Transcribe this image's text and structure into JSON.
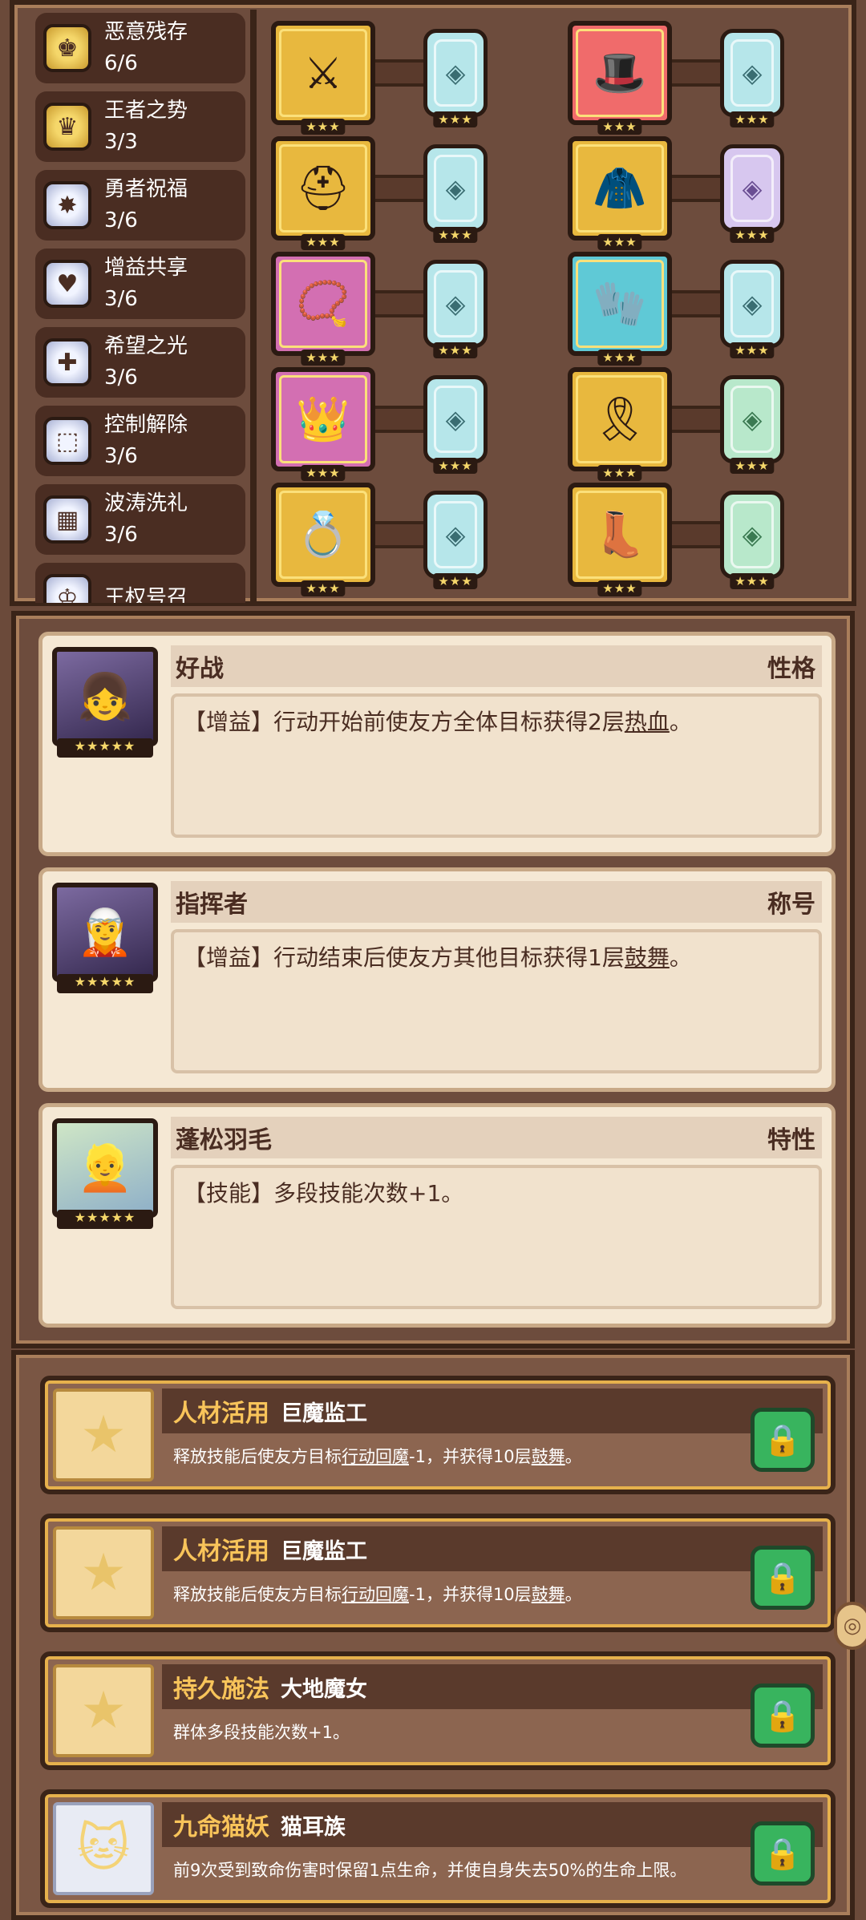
{
  "sets": [
    {
      "name": "恶意残存",
      "count": "6/6",
      "icon": "gold-medal-icon",
      "tone": "gold"
    },
    {
      "name": "王者之势",
      "count": "3/3",
      "icon": "gold-emblem-icon",
      "tone": "gold"
    },
    {
      "name": "勇者祝福",
      "count": "3/6",
      "icon": "silver-star-icon",
      "tone": "silver"
    },
    {
      "name": "增益共享",
      "count": "3/6",
      "icon": "silver-heart-icon",
      "tone": "silver"
    },
    {
      "name": "希望之光",
      "count": "3/6",
      "icon": "silver-plus-icon",
      "tone": "silver"
    },
    {
      "name": "控制解除",
      "count": "3/6",
      "icon": "silver-lock-icon",
      "tone": "silver"
    },
    {
      "name": "波涛洗礼",
      "count": "3/6",
      "icon": "silver-wave-icon",
      "tone": "silver"
    },
    {
      "name": "王权号召",
      "count": "",
      "icon": "silver-crown-icon",
      "tone": "silver"
    }
  ],
  "equip_rows": [
    {
      "left": {
        "icon": "sword-icon",
        "glyph": "⚔",
        "tone": "gold",
        "stars": "★★★",
        "gem": "gem-icon",
        "gem_glyph": "◈",
        "gem_tone": "cyan"
      },
      "right": {
        "icon": "hat-icon",
        "glyph": "🎩",
        "tone": "red",
        "stars": "★★★",
        "gem": "gem-icon",
        "gem_glyph": "◈",
        "gem_tone": "cyan"
      }
    },
    {
      "left": {
        "icon": "helmet-icon",
        "glyph": "⛑",
        "tone": "gold",
        "stars": "★★★",
        "gem": "gem-icon",
        "gem_glyph": "◈",
        "gem_tone": "cyan"
      },
      "right": {
        "icon": "armor-icon",
        "glyph": "🧥",
        "tone": "gold",
        "stars": "★★★",
        "gem": "gem-icon",
        "gem_glyph": "◈",
        "gem_tone": "purple"
      }
    },
    {
      "left": {
        "icon": "necklace-icon",
        "glyph": "📿",
        "tone": "pink",
        "stars": "★★★",
        "gem": "gem-icon",
        "gem_glyph": "◈",
        "gem_tone": "cyan"
      },
      "right": {
        "icon": "glove-icon",
        "glyph": "🧤",
        "tone": "cyan",
        "stars": "★★★",
        "gem": "gem-icon",
        "gem_glyph": "◈",
        "gem_tone": "cyan"
      }
    },
    {
      "left": {
        "icon": "crown-icon",
        "glyph": "👑",
        "tone": "pink",
        "stars": "★★★",
        "gem": "gem-icon",
        "gem_glyph": "◈",
        "gem_tone": "cyan"
      },
      "right": {
        "icon": "belt-icon",
        "glyph": "🎗",
        "tone": "gold",
        "stars": "★★★",
        "gem": "gem-icon",
        "gem_glyph": "◈",
        "gem_tone": "green"
      }
    },
    {
      "left": {
        "icon": "ring-icon",
        "glyph": "💍",
        "tone": "gold",
        "stars": "★★★",
        "gem": "gem-icon",
        "gem_glyph": "◈",
        "gem_tone": "cyan"
      },
      "right": {
        "icon": "boots-icon",
        "glyph": "👢",
        "tone": "gold",
        "stars": "★★★",
        "gem": "gem-icon",
        "gem_glyph": "◈",
        "gem_tone": "green"
      }
    }
  ],
  "traits": [
    {
      "title": "好战",
      "type": "性格",
      "desc_prefix": "【增益】行动开始前使友方全体目标获得2层",
      "desc_key": "热血",
      "desc_suffix": "。",
      "stars": "★★★★★",
      "portrait": "dark-hair-hero-portrait"
    },
    {
      "title": "指挥者",
      "type": "称号",
      "desc_prefix": "【增益】行动结束后使友方其他目标获得1层",
      "desc_key": "鼓舞",
      "desc_suffix": "。",
      "stars": "★★★★★",
      "portrait": "purple-hair-hero-portrait"
    },
    {
      "title": "蓬松羽毛",
      "type": "特性",
      "desc_prefix": "【技能】多段技能次数+1。",
      "desc_key": "",
      "desc_suffix": "",
      "stars": "★★★★★",
      "portrait": "blonde-hero-portrait"
    }
  ],
  "talents": [
    {
      "name": "人材活用",
      "source": "巨魔监工",
      "desc_a": "释放技能后使友方目标",
      "desc_key1": "行动回魔",
      "desc_b": "-1，并获得10层",
      "desc_key2": "鼓舞",
      "desc_c": "。",
      "icon_tone": "gold"
    },
    {
      "name": "人材活用",
      "source": "巨魔监工",
      "desc_a": "释放技能后使友方目标",
      "desc_key1": "行动回魔",
      "desc_b": "-1，并获得10层",
      "desc_key2": "鼓舞",
      "desc_c": "。",
      "icon_tone": "gold"
    },
    {
      "name": "持久施法",
      "source": "大地魔女",
      "desc_a": "群体多段技能次数+1。",
      "desc_key1": "",
      "desc_b": "",
      "desc_key2": "",
      "desc_c": "",
      "icon_tone": "gold"
    },
    {
      "name": "九命猫妖",
      "source": "猫耳族",
      "desc_a": "前9次受到致命伤害时保留1点生命，并使自身失去50%的生命上限。",
      "desc_key1": "",
      "desc_b": "",
      "desc_key2": "",
      "desc_c": "",
      "icon_tone": "silver"
    }
  ]
}
